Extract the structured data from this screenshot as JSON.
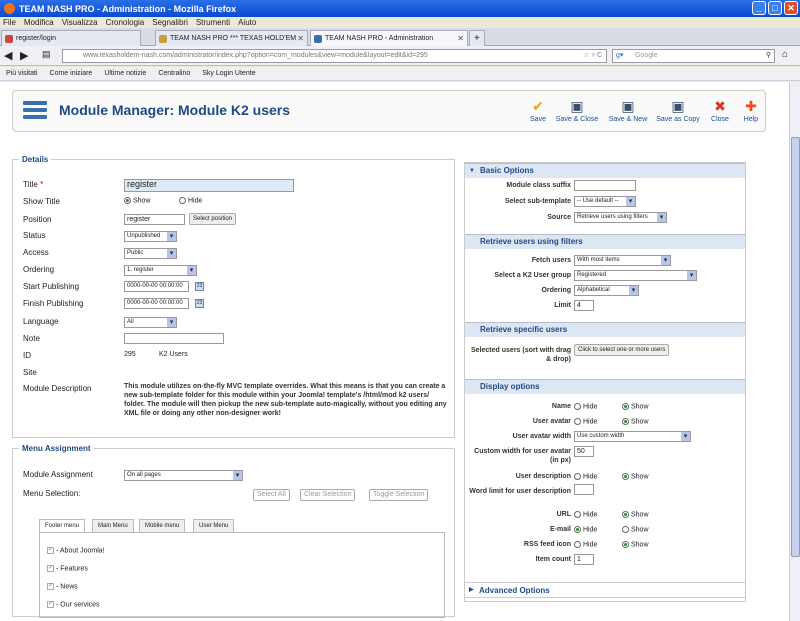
{
  "window": {
    "title": "TEAM NASH PRO - Administration - Mozilla Firefox"
  },
  "menubar": [
    "File",
    "Modifica",
    "Visualizza",
    "Cronologia",
    "Segnalibri",
    "Strumenti",
    "Aiuto"
  ],
  "tabs": [
    {
      "label": "register/login"
    },
    {
      "label": "TEAM NASH PRO *** TEXAS HOLD'EM"
    },
    {
      "label": "TEAM NASH PRO - Administration"
    }
  ],
  "nav": {
    "url": "www.texasholdem-nash.com/administrator/index.php?option=com_modules&view=module&layout=edit&id=295",
    "search_placeholder": "Google"
  },
  "bookmarks": [
    "Più visitati",
    "Come iniziare",
    "Ultime notizie",
    "Centralino",
    "Sky Login Utente"
  ],
  "header": {
    "title": "Module Manager: Module K2 users",
    "buttons": [
      {
        "label": "Save",
        "icon": "check-icon",
        "color": "#e8a01e"
      },
      {
        "label": "Save & Close",
        "icon": "disk-icon",
        "color": "#3b4f6a"
      },
      {
        "label": "Save & New",
        "icon": "disk-plus-icon",
        "color": "#3b4f6a"
      },
      {
        "label": "Save as Copy",
        "icon": "disk-copy-icon",
        "color": "#3b4f6a"
      },
      {
        "label": "Close",
        "icon": "close-icon",
        "color": "#d9362a"
      },
      {
        "label": "Help",
        "icon": "lifebuoy-icon",
        "color": "#e84f1e"
      }
    ]
  },
  "details": {
    "legend": "Details",
    "title_label": "Title",
    "title_value": "register",
    "show_title_label": "Show Title",
    "show_label": "Show",
    "hide_label": "Hide",
    "position_label": "Position",
    "position_value": "register",
    "select_position": "Select position",
    "status_label": "Status",
    "status_value": "Unpublished",
    "access_label": "Access",
    "access_value": "Public",
    "ordering_label": "Ordering",
    "ordering_value": "1. register",
    "start_label": "Start Publishing",
    "start_value": "0000-00-00 00:00:00",
    "finish_label": "Finish Publishing",
    "finish_value": "0000-00-00 00:00:00",
    "language_label": "Language",
    "language_value": "All",
    "note_label": "Note",
    "id_label": "ID",
    "id_value": "295",
    "id_type": "K2 Users",
    "site_label": "Site",
    "module_desc_label": "Module Description",
    "module_desc": "This module utilizes on-the-fly MVC template overrides. What this means is that you can create a new sub-template folder for this module within your Joomla! template's /html/mod k2 users/ folder. The module will then pickup the new sub-template auto-magically, without you editing any XML file or doing any other non-designer work!"
  },
  "menu_assignment": {
    "legend": "Menu Assignment",
    "assignment_label": "Module Assignment",
    "assignment_value": "On all pages",
    "selection_label": "Menu Selection:",
    "select_all": "Select All",
    "clear_selection": "Clear Selection",
    "toggle_selection": "Toggle Selection",
    "tabs": [
      "Footer menu",
      "Main Menu",
      "Mobile menu",
      "User Menu"
    ],
    "items": [
      "- About Joomla!",
      "- Features",
      "- News",
      "- Our services"
    ]
  },
  "basic": {
    "title": "Basic Options",
    "class_suffix_label": "Module class suffix",
    "subtemplate_label": "Select sub-template",
    "subtemplate_value": "-- Use default --",
    "source_label": "Source",
    "source_value": "Retrieve users using filters"
  },
  "filters": {
    "title": "Retrieve users using filters",
    "fetch_label": "Fetch users",
    "fetch_value": "With most items",
    "group_label": "Select a K2 User group",
    "group_value": "Registered",
    "ordering_label": "Ordering",
    "ordering_value": "Alphabetical",
    "limit_label": "Limit",
    "limit_value": "4"
  },
  "specific": {
    "title": "Retrieve specific users",
    "selected_label": "Selected users (sort with drag & drop)",
    "button": "Click to select one or more users"
  },
  "display": {
    "title": "Display options",
    "hide": "Hide",
    "show": "Show",
    "name_label": "Name",
    "avatar_label": "User avatar",
    "avatar_width_label": "User avatar width",
    "avatar_width_value": "Use custom width",
    "custom_width_label": "Custom width for user avatar (in px)",
    "custom_width_value": "50",
    "desc_label": "User description",
    "word_limit_label": "Word limit for user description",
    "url_label": "URL",
    "email_label": "E-mail",
    "rss_label": "RSS feed icon",
    "item_count_label": "Item count",
    "item_count_value": "1"
  },
  "advanced": {
    "title": "Advanced Options"
  }
}
